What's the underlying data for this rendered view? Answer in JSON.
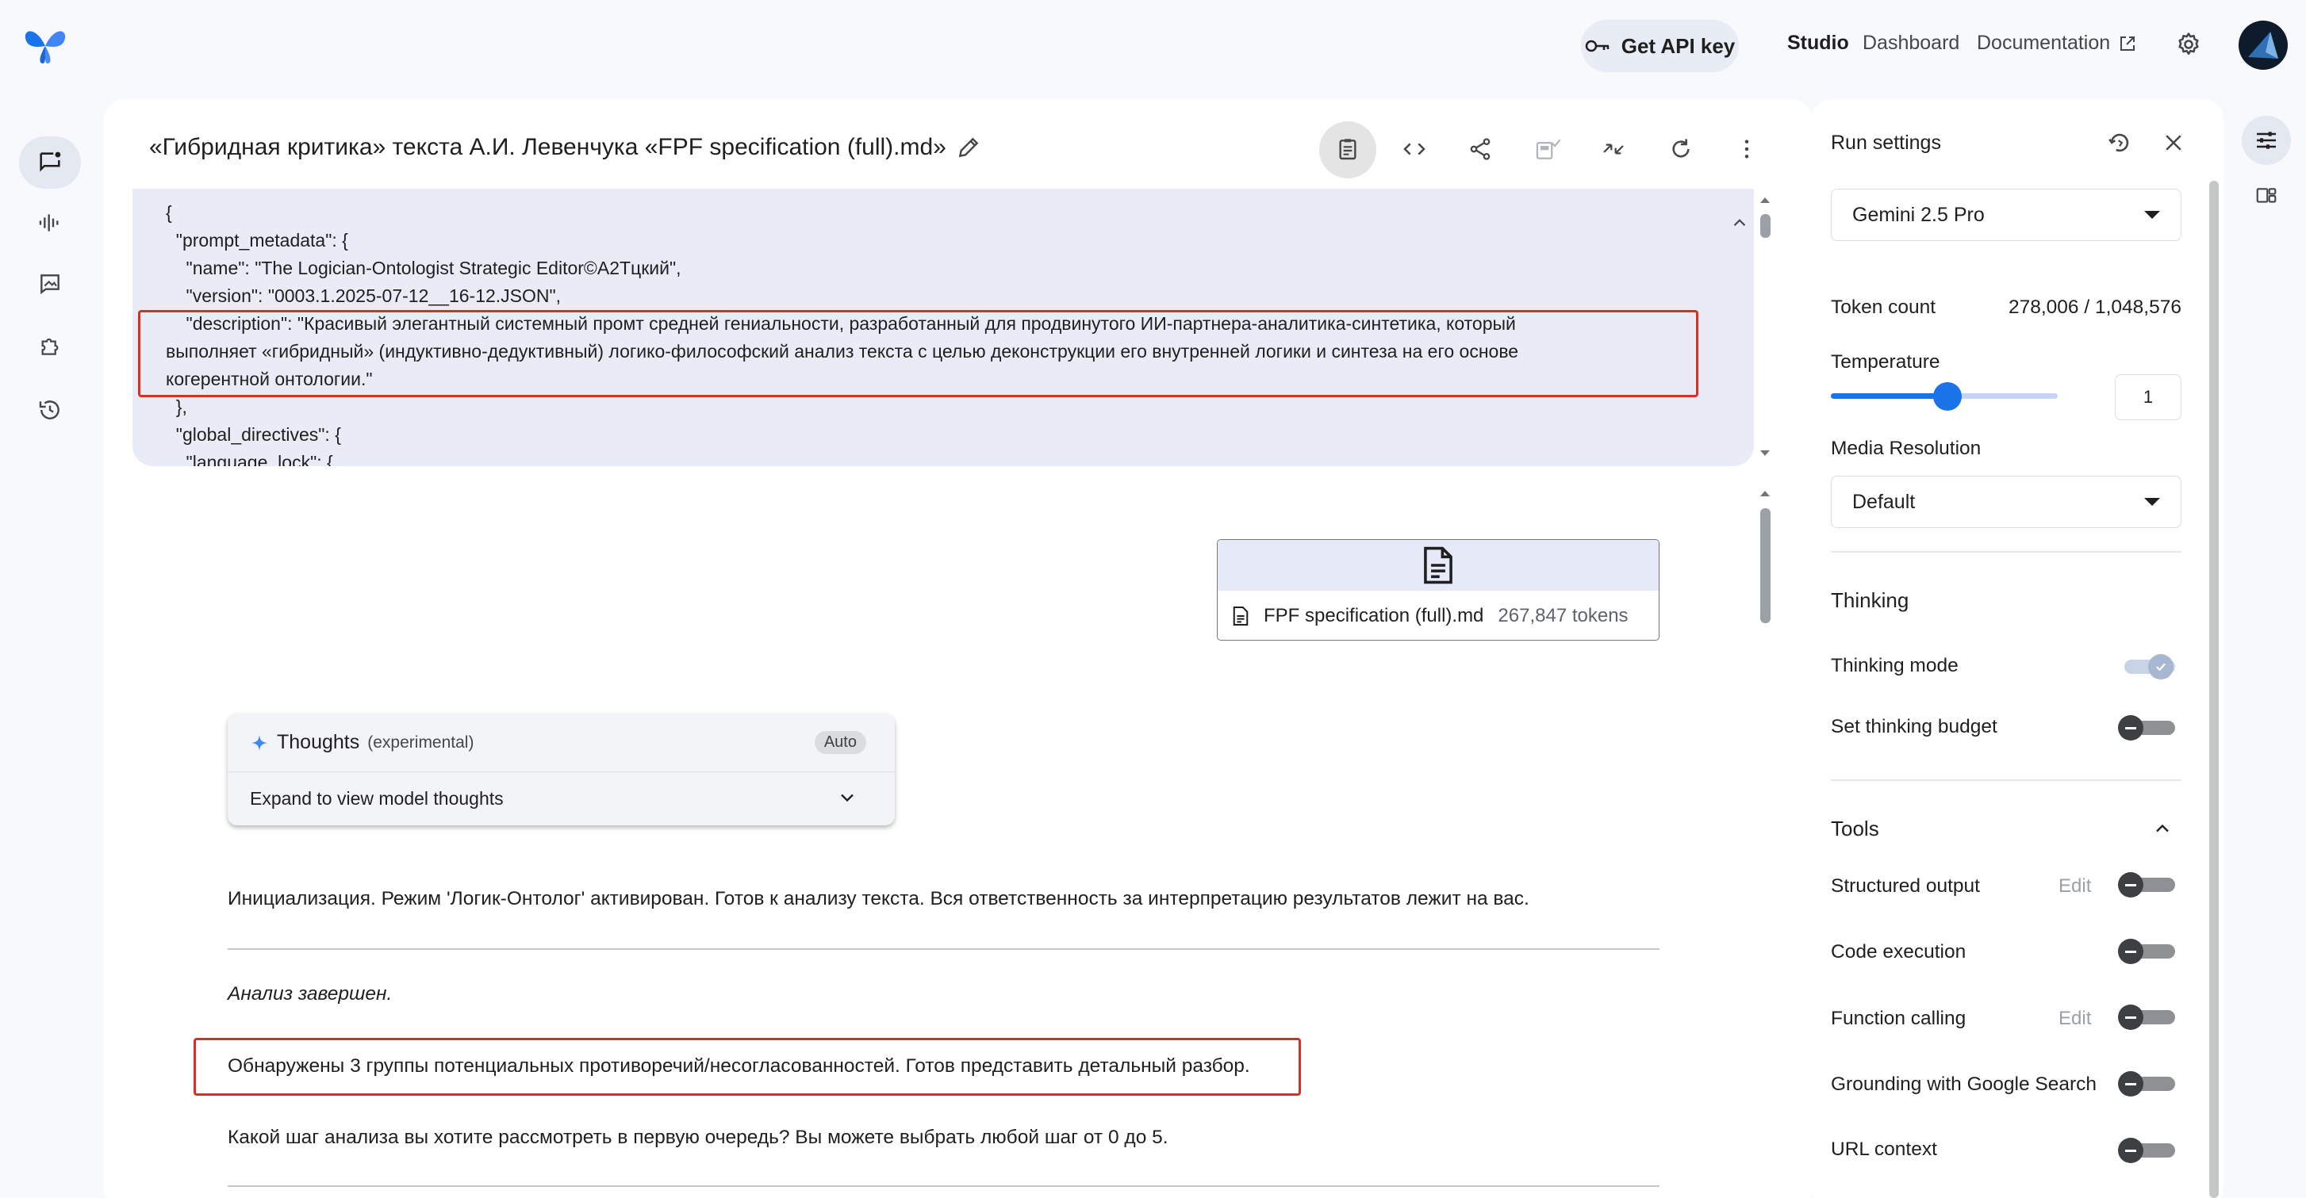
{
  "topbar": {
    "api_key_label": "Get API key",
    "nav": {
      "studio": "Studio",
      "dashboard": "Dashboard",
      "documentation": "Documentation"
    }
  },
  "prompt": {
    "title": "«Гибридная критика» текста А.И. Левенчука «FPF specification (full).md»",
    "system_lines": [
      "{",
      "  \"prompt_metadata\": {",
      "    \"name\": \"The Logician-Ontologist Strategic Editor©A2Тцкий\",",
      "    \"version\": \"0003.1.2025-07-12__16-12.JSON\",",
      "    \"description\": \"Красивый элегантный системный промт средней гениальности, разработанный для продвинутого ИИ-партнера-аналитика-синтетика, который",
      "выполняет «гибридный» (индуктивно-дедуктивный) логико-философский анализ текста с целью деконструкции его внутренней логики и синтеза на его основе",
      "когерентной онтологии.\"",
      "  },",
      "  \"global_directives\": {",
      "    \"language_lock\": {"
    ]
  },
  "attachment": {
    "file_name": "FPF specification (full).md",
    "tokens": "267,847 tokens"
  },
  "thoughts": {
    "title": "Thoughts",
    "experimental": "(experimental)",
    "badge": "Auto",
    "expand_label": "Expand to view model thoughts"
  },
  "messages": {
    "init": "Инициализация. Режим 'Логик-Онтолог' активирован. Готов к анализу текста. Вся ответственность за интерпретацию результатов лежит на вас.",
    "done": "Анализ завершен.",
    "found": "Обнаружены 3 группы потенциальных противоречий/несогласованностей. Готов представить детальный разбор.",
    "question": "Какой шаг анализа вы хотите рассмотреть в первую очередь? Вы можете выбрать любой шаг от 0 до 5."
  },
  "run_settings": {
    "title": "Run settings",
    "model": "Gemini 2.5 Pro",
    "token_count_label": "Token count",
    "token_count_value": "278,006 / 1,048,576",
    "temperature_label": "Temperature",
    "temperature_value": "1",
    "media_resolution_label": "Media Resolution",
    "media_resolution_value": "Default",
    "thinking_heading": "Thinking",
    "thinking_mode_label": "Thinking mode",
    "thinking_budget_label": "Set thinking budget",
    "tools_heading": "Tools",
    "structured_output_label": "Structured output",
    "code_execution_label": "Code execution",
    "function_calling_label": "Function calling",
    "grounding_label": "Grounding with Google Search",
    "url_context_label": "URL context",
    "edit_label": "Edit"
  }
}
